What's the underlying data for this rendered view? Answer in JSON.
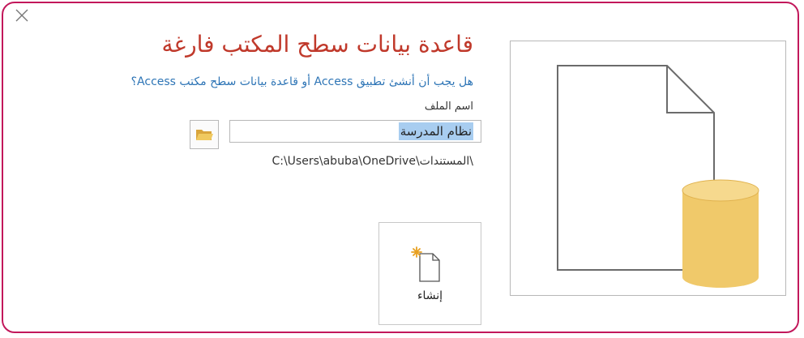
{
  "dialog": {
    "title": "قاعدة بيانات سطح المكتب فارغة",
    "question": "هل يجب أن أنشئ تطبيق Access أو قاعدة بيانات سطح مكتب Access؟",
    "file_name_label": "اسم الملف",
    "file_name_value": "نظام المدرسة",
    "save_path": "C:\\Users\\abuba\\OneDrive\\المستندات\\",
    "create_button_label": "إنشاء"
  },
  "icons": {
    "close": "close-icon",
    "browse": "folder-icon",
    "create": "new-document-icon",
    "preview": "database-document-icon"
  },
  "colors": {
    "frame_border": "#c2185b",
    "title": "#c0392b",
    "question": "#2e75b6",
    "selection": "#a8cdf0",
    "folder": "#e8b84d",
    "database": "#f0c96a"
  }
}
